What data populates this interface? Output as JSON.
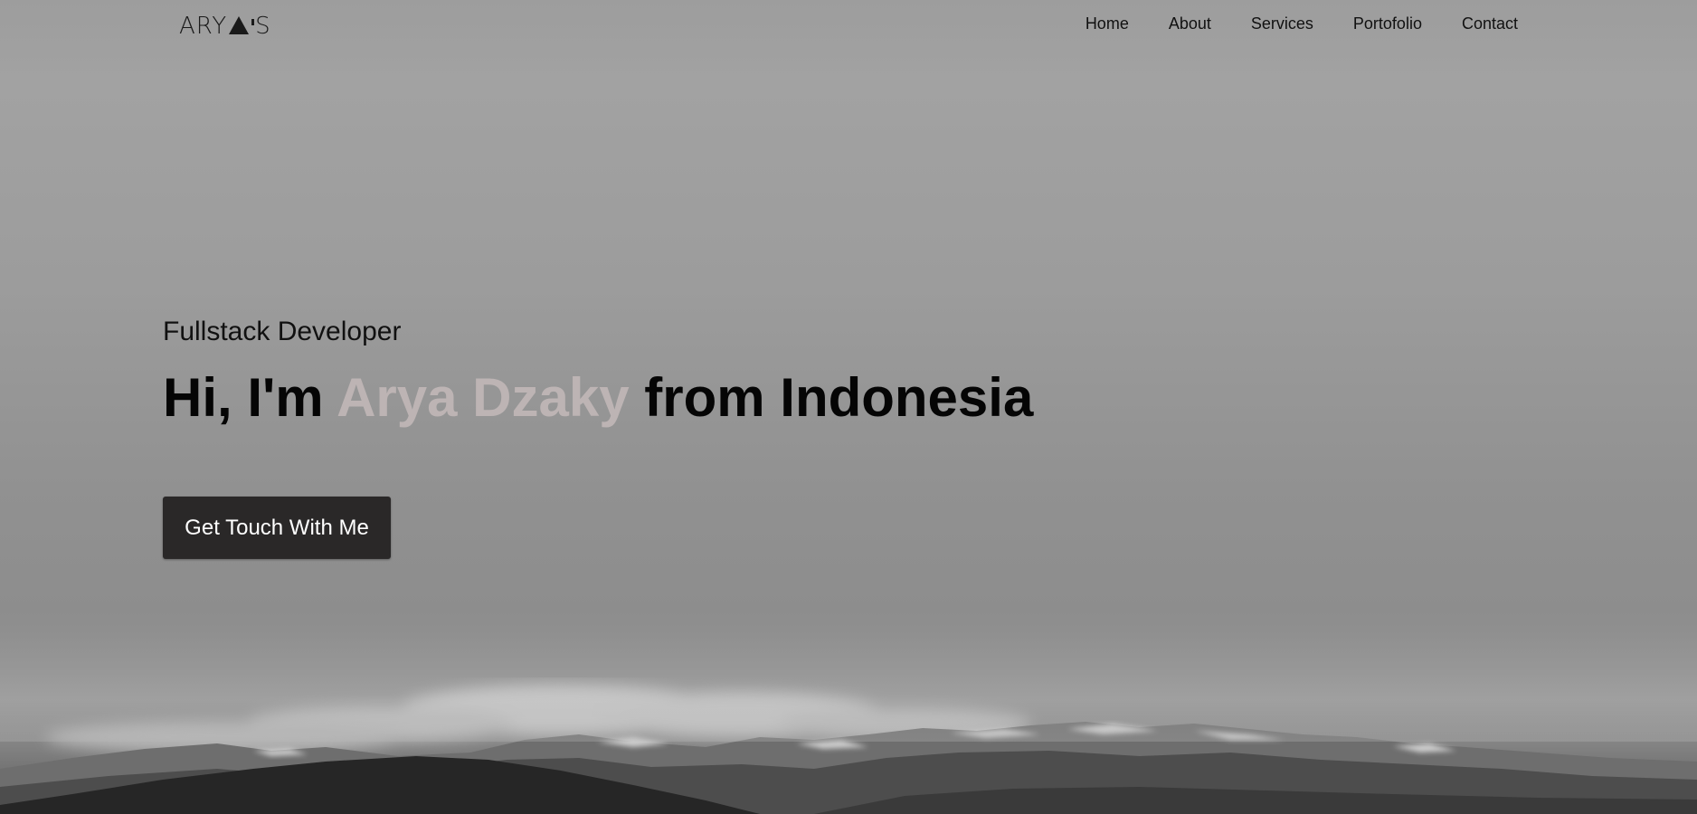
{
  "brand": {
    "logo_left": "ARY",
    "logo_right": "S"
  },
  "nav": {
    "items": [
      {
        "label": "Home"
      },
      {
        "label": "About"
      },
      {
        "label": "Services"
      },
      {
        "label": "Portofolio"
      },
      {
        "label": "Contact"
      }
    ]
  },
  "hero": {
    "subtitle": "Fullstack Developer",
    "headline_prefix": "Hi, I'm ",
    "headline_name": "Arya Dzaky",
    "headline_suffix": " from Indonesia",
    "cta_label": "Get Touch With Me"
  },
  "colors": {
    "name_accent": "#bdb4b4",
    "button_bg": "#2a2828"
  }
}
